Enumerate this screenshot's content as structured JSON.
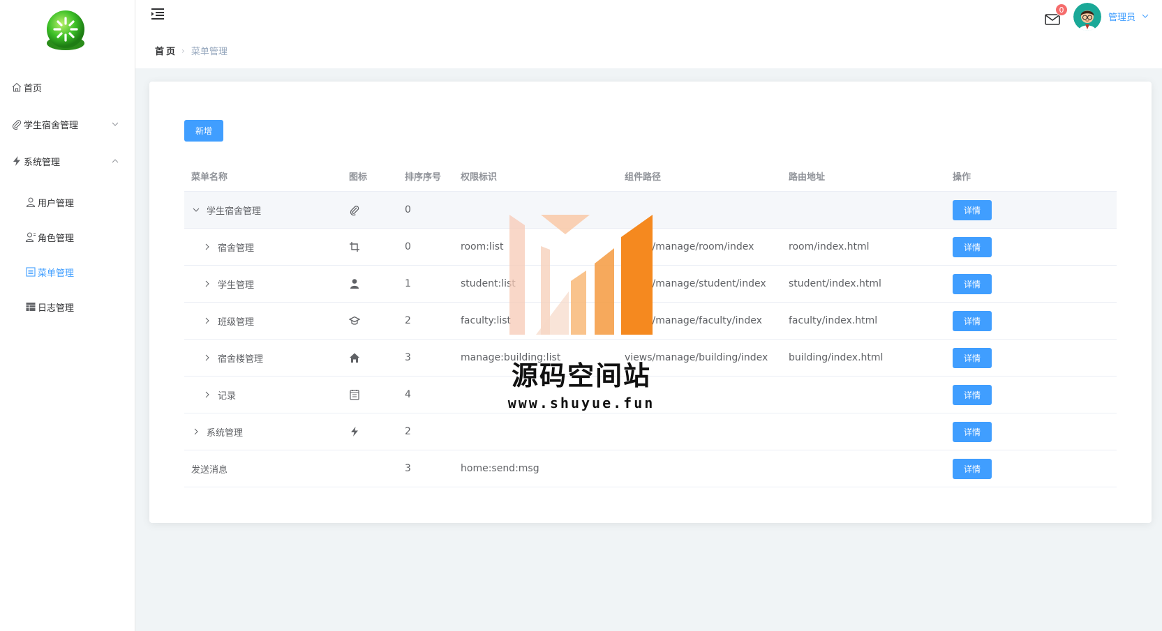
{
  "sidebar": {
    "items": [
      {
        "label": "首页",
        "icon": "home-icon"
      },
      {
        "label": "学生宿舍管理",
        "icon": "paperclip-icon",
        "arrow": "down"
      },
      {
        "label": "系统管理",
        "icon": "lightning-icon",
        "arrow": "up"
      },
      {
        "label": "用户管理",
        "icon": "user-icon"
      },
      {
        "label": "角色管理",
        "icon": "user-setting-icon"
      },
      {
        "label": "菜单管理",
        "icon": "tickets-icon",
        "active": true
      },
      {
        "label": "日志管理",
        "icon": "table-icon"
      }
    ]
  },
  "header": {
    "breadcrumb": {
      "home": "首页",
      "current": "菜单管理"
    },
    "mail_badge": "0",
    "user_name": "管理员"
  },
  "toolbar": {
    "add_label": "新增"
  },
  "table": {
    "columns": [
      "菜单名称",
      "图标",
      "排序序号",
      "权限标识",
      "组件路径",
      "路由地址",
      "操作"
    ],
    "detail_label": "详情",
    "rows": [
      {
        "name": "学生宿舍管理",
        "icon": "paperclip-icon",
        "order": "0",
        "perm": "",
        "component": "",
        "route": "",
        "level": 0,
        "expand": "down"
      },
      {
        "name": "宿舍管理",
        "icon": "crop-icon",
        "order": "0",
        "perm": "room:list",
        "component": "views/manage/room/index",
        "route": "room/index.html",
        "level": 1,
        "expand": "right"
      },
      {
        "name": "学生管理",
        "icon": "user-solid-icon",
        "order": "1",
        "perm": "student:list",
        "component": "views/manage/student/index",
        "route": "student/index.html",
        "level": 1,
        "expand": "right"
      },
      {
        "name": "班级管理",
        "icon": "graduation-cap-icon",
        "order": "2",
        "perm": "faculty:list",
        "component": "views/manage/faculty/index",
        "route": "faculty/index.html",
        "level": 1,
        "expand": "right"
      },
      {
        "name": "宿舍楼管理",
        "icon": "house-icon",
        "order": "3",
        "perm": "manage:building:list",
        "component": "views/manage/building/index",
        "route": "building/index.html",
        "level": 1,
        "expand": "right"
      },
      {
        "name": "记录",
        "icon": "notebook-icon",
        "order": "4",
        "perm": "",
        "component": "",
        "route": "",
        "level": 1,
        "expand": "right"
      },
      {
        "name": "系统管理",
        "icon": "lightning-icon",
        "order": "2",
        "perm": "",
        "component": "",
        "route": "",
        "level": 0,
        "expand": "right"
      },
      {
        "name": "发送消息",
        "icon": "",
        "order": "3",
        "perm": "home:send:msg",
        "component": "",
        "route": "",
        "level": 0,
        "expand": "none"
      }
    ]
  },
  "watermark": {
    "title": "源码空间站",
    "url": "www.shuyue.fun"
  },
  "colors": {
    "primary": "#409eff",
    "badge": "#f56c6c",
    "watermark_orange": "#f5891f"
  }
}
